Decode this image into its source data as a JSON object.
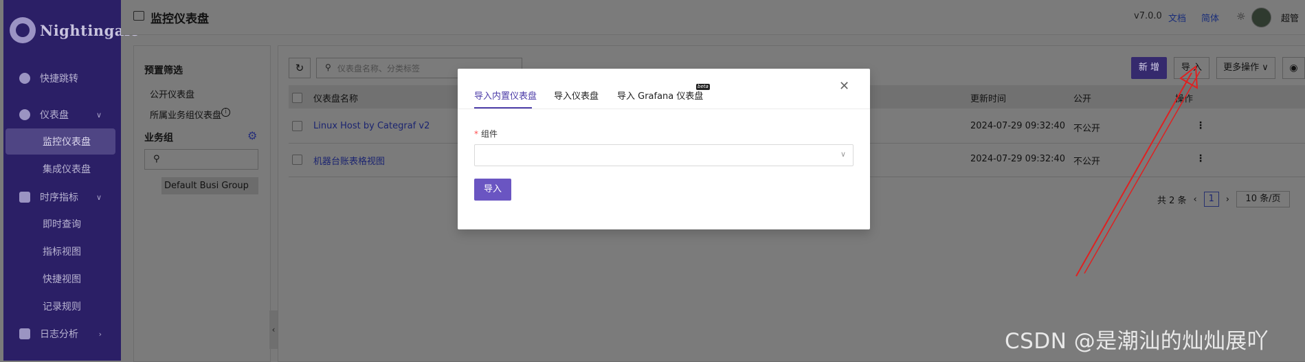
{
  "app": {
    "logo_text": "Nightingale",
    "version": "v7.0.0",
    "docs_label": "文档",
    "lang_label": "简体",
    "theme_icon": "sun-icon",
    "user_name": "超管"
  },
  "sidebar": {
    "items": [
      {
        "label": "快捷跳转",
        "icon": "search-icon"
      },
      {
        "label": "仪表盘",
        "icon": "dashboard-icon",
        "expanded": true
      },
      {
        "label": "监控仪表盘",
        "active": true
      },
      {
        "label": "集成仪表盘"
      },
      {
        "label": "时序指标",
        "icon": "line-chart-icon",
        "expanded": true
      },
      {
        "label": "即时查询"
      },
      {
        "label": "指标视图"
      },
      {
        "label": "快捷视图"
      },
      {
        "label": "记录规则"
      },
      {
        "label": "日志分析",
        "icon": "log-icon",
        "expanded": false
      }
    ]
  },
  "page": {
    "title": "监控仪表盘"
  },
  "filter_panel": {
    "preset_title": "预置筛选",
    "public_dashboards": "公开仪表盘",
    "busi_group_dashboards": "所属业务组仪表盘",
    "busi_group_title": "业务组",
    "busi_groups": [
      "Default Busi Group"
    ]
  },
  "toolbar": {
    "search_placeholder": "仪表盘名称、分类标签",
    "add_label": "新 增",
    "import_label": "导 入",
    "more_label": "更多操作"
  },
  "table": {
    "columns": [
      "仪表盘名称",
      "更新时间",
      "公开",
      "操作"
    ],
    "rows": [
      {
        "name": "Linux Host by Categraf v2",
        "updated": "2024-07-29 09:32:40",
        "public": "不公开",
        "action": "⋮"
      },
      {
        "name": "机器台账表格视图",
        "updated": "2024-07-29 09:32:40",
        "public": "不公开",
        "action": "⋮"
      }
    ]
  },
  "pagination": {
    "total": "共 2 条",
    "current": "1",
    "page_size": "10 条/页"
  },
  "modal": {
    "tabs": [
      "导入内置仪表盘",
      "导入仪表盘",
      "导入 Grafana 仪表盘"
    ],
    "active_tab": 0,
    "beta_tag": "beta",
    "component_label": "组件",
    "component_value": "",
    "import_button": "导入"
  },
  "colors": {
    "accent": "#6a55c2",
    "annotation_arrow": "#e02020"
  },
  "watermark": "CSDN @是潮汕的灿灿展吖"
}
